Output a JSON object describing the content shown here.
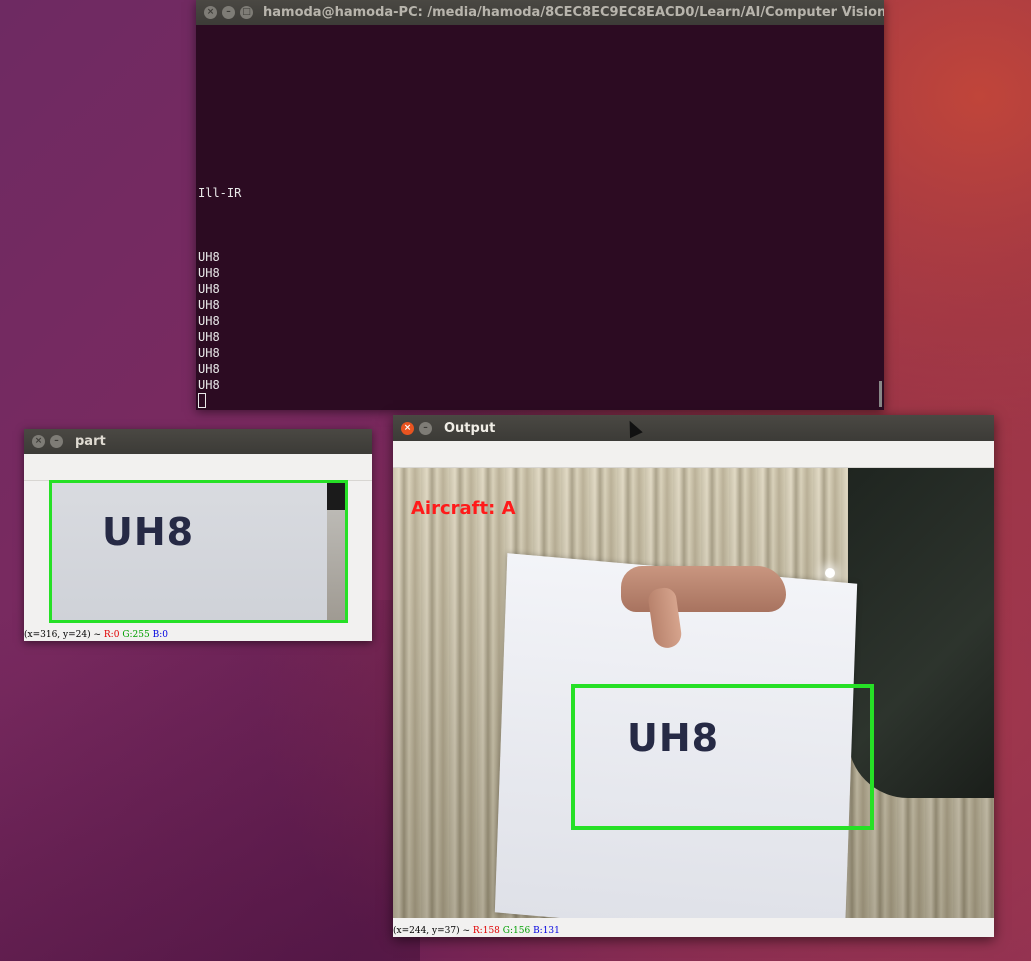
{
  "terminal": {
    "title": "hamoda@hamoda-PC: /media/hamoda/8CEC8EC9EC8EACD0/Learn/AI/Computer Vision/p",
    "lines": [
      "Ill-IR",
      "UH8",
      "UH8",
      "UH8",
      "UH8",
      "UH8",
      "UH8",
      "UH8",
      "UH8",
      "UH8"
    ]
  },
  "part_window": {
    "title": "part",
    "plate_text": "UH8",
    "status": {
      "coords": "(x=316, y=24) ~",
      "r": "R:0",
      "g": "G:255",
      "b": "B:0"
    }
  },
  "output_window": {
    "title": "Output",
    "overlay_label": "Aircraft: A",
    "plate_text": "UH8",
    "status": {
      "coords": "(x=244, y=37) ~",
      "r": "R:158",
      "g": "G:156",
      "b": "B:131"
    }
  },
  "colors": {
    "detection_box": "#26e026",
    "overlay_text": "#ff1a1a",
    "terminal_bg": "#2c0b22",
    "close_button": "#e95420"
  }
}
